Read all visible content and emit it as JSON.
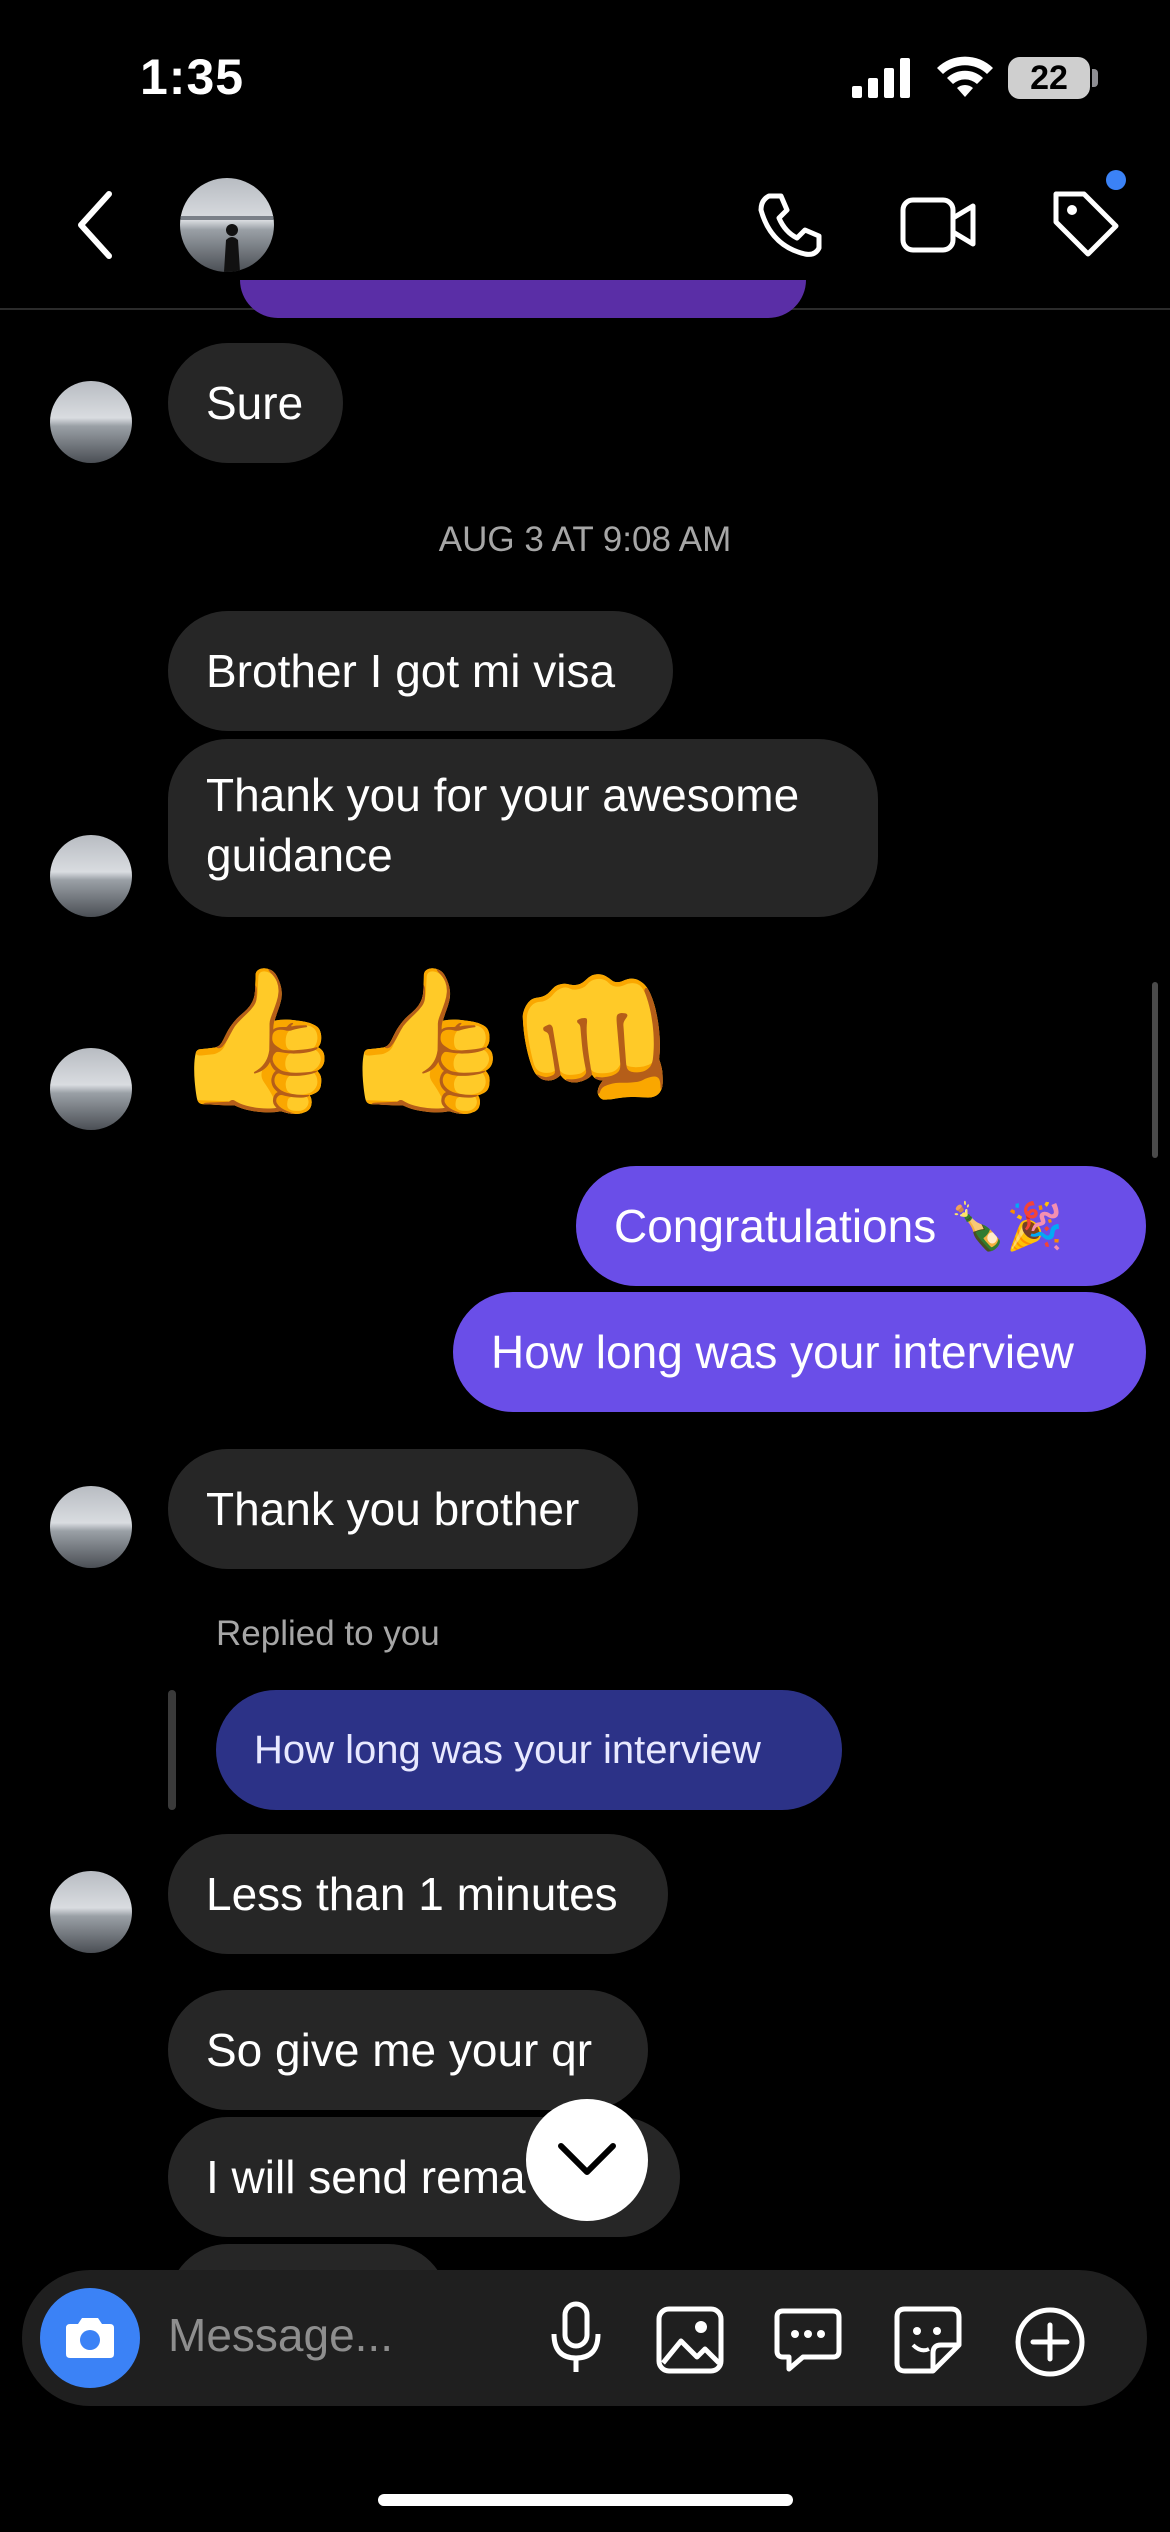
{
  "status_bar": {
    "time": "1:35",
    "battery": "22"
  },
  "header": {
    "badge_color": "#3b82f6"
  },
  "date_separator": "AUG 3 AT 9:08 AM",
  "messages": {
    "sure": "Sure",
    "visa": "Brother I got mi visa",
    "thanks_line1": "Thank you for your awesome",
    "thanks_line2": "guidance",
    "emoji": "👍👍👊",
    "congrats": "Congratulations 🍾🎉",
    "interview_q": "How long was your interview",
    "thank_brother": "Thank you brother",
    "replied_label": "Replied to you",
    "quoted": "How long was your interview",
    "less_than": "Less than 1 minutes",
    "give_qr": "So give me your qr",
    "send_rem": "I will send rema"
  },
  "composer": {
    "placeholder": "Message..."
  },
  "colors": {
    "outgoing": "#6a4ee8",
    "incoming": "#262626",
    "quote": "#2c3287",
    "camera": "#3b82f6"
  }
}
